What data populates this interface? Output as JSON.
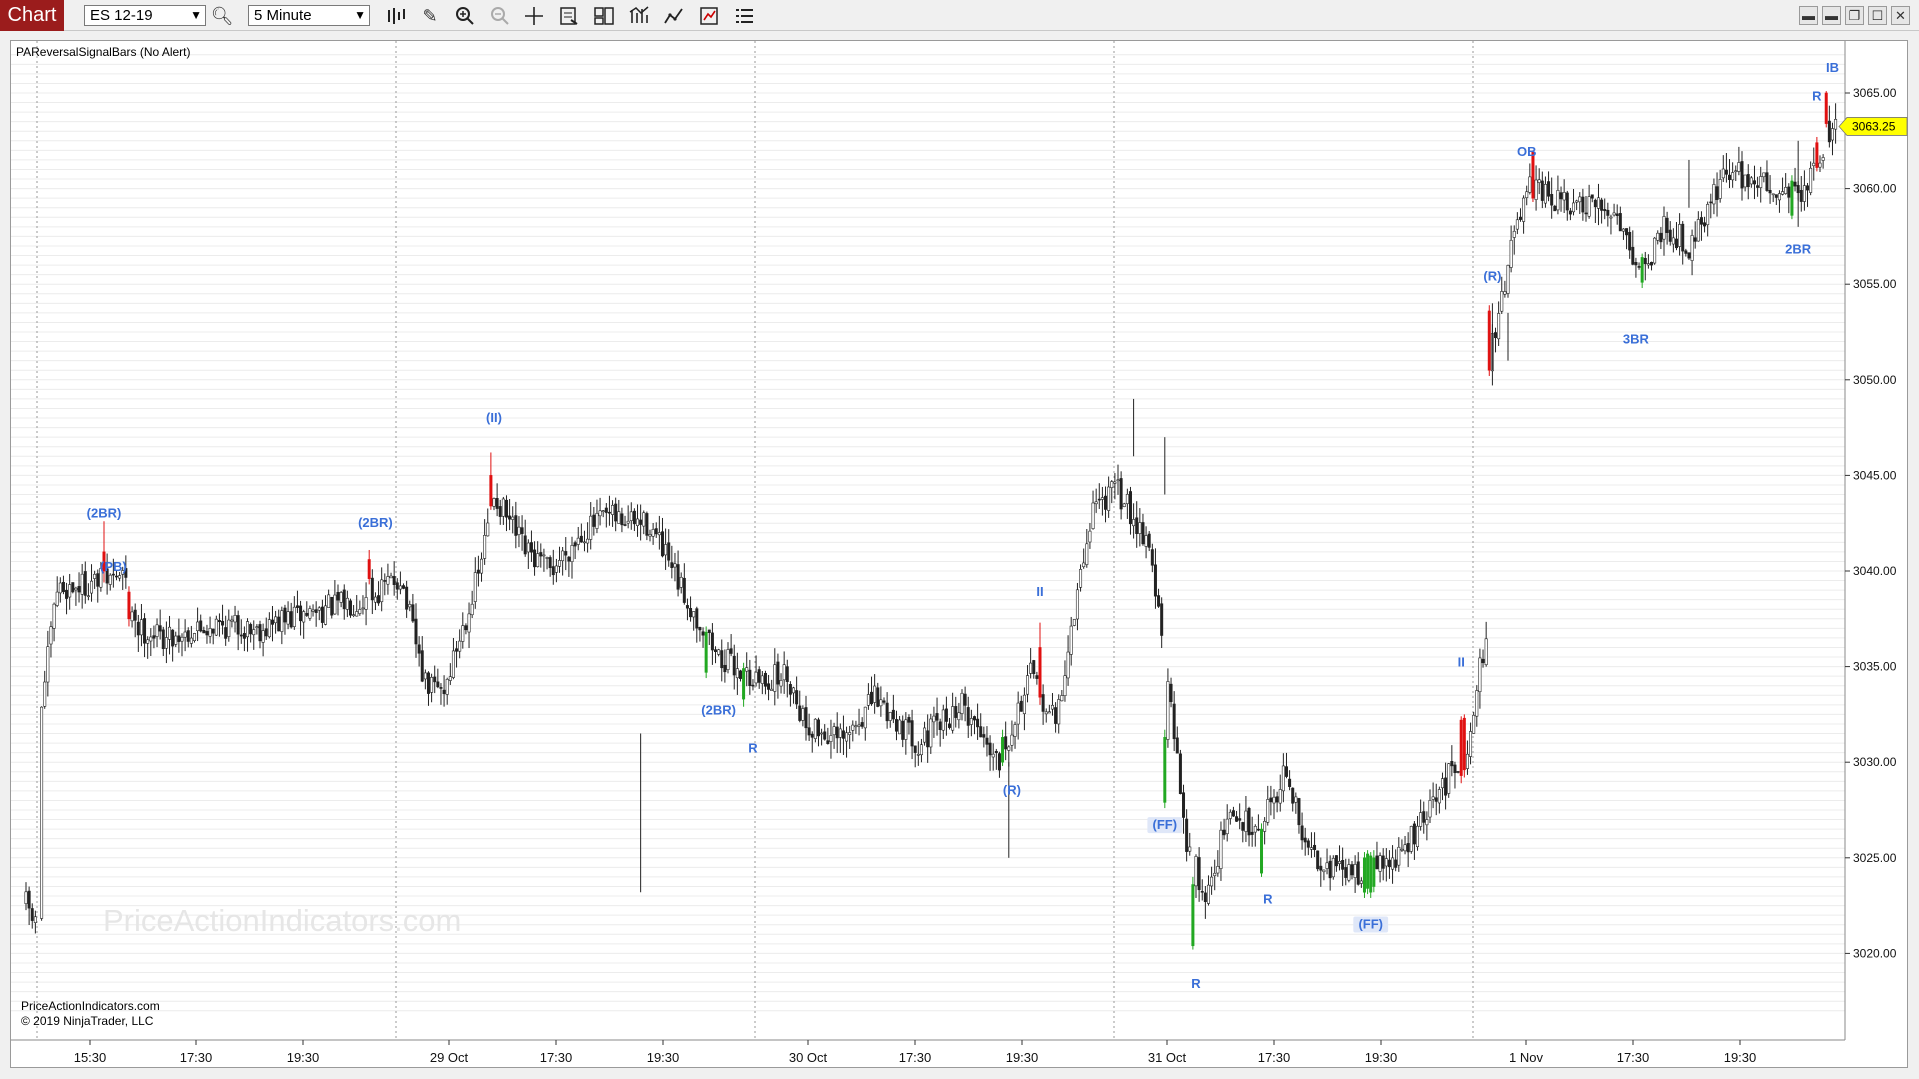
{
  "toolbar": {
    "tab_label": "Chart",
    "instrument": "ES 12-19",
    "timeframe": "5 Minute",
    "icons": [
      "bar-type-icon",
      "draw-tool-icon",
      "zoom-in-icon",
      "zoom-out-icon",
      "crosshair-icon",
      "properties-icon",
      "data-box-icon",
      "indicators-icon",
      "strategies-icon",
      "chart-trader-icon",
      "menu-icon"
    ],
    "window_buttons": [
      "tile-icon",
      "tile-icon",
      "restore-icon",
      "maximize-icon",
      "close-icon"
    ]
  },
  "chart": {
    "indicator_label": "PAReversalSignalBars (No Alert)",
    "watermark": "PriceActionIndicators.com",
    "copyright_lines": [
      "PriceActionIndicators.com",
      "© 2019 NinjaTrader, LLC"
    ],
    "last_price": "3063.25",
    "colors": {
      "bullish_signal": "#22a822",
      "bearish_signal": "#e01010",
      "signal_label": "#3a6fd8",
      "price_badge": "#ffff00"
    }
  },
  "chart_data": {
    "type": "candlestick",
    "y_tick_labels": [
      "3065.00",
      "3060.00",
      "3055.00",
      "3050.00",
      "3045.00",
      "3040.00",
      "3035.00",
      "3030.00",
      "3025.00",
      "3020.00"
    ],
    "x_tick_labels": [
      "15:30",
      "17:30",
      "19:30",
      "29 Oct",
      "17:30",
      "19:30",
      "30 Oct",
      "17:30",
      "19:30",
      "31 Oct",
      "17:30",
      "19:30",
      "1 Nov",
      "17:30",
      "19:30"
    ],
    "ylim": [
      3017.0,
      3067.0
    ],
    "grid": true,
    "session_breaks": [
      "29 Oct",
      "30 Oct",
      "31 Oct",
      "1 Nov"
    ],
    "signal_labels": [
      {
        "text": "(2BR)",
        "price": 3042.8,
        "bar": 25,
        "kind": "bear"
      },
      {
        "text": "(PB)",
        "price": 3040.0,
        "bar": 28,
        "kind": "bear"
      },
      {
        "text": "(2BR)",
        "price": 3042.3,
        "bar": 112,
        "kind": "bear"
      },
      {
        "text": "(II)",
        "price": 3047.8,
        "bar": 150,
        "kind": "bear"
      },
      {
        "text": "(2BR)",
        "price": 3032.5,
        "bar": 222,
        "kind": "bull"
      },
      {
        "text": "R",
        "price": 3030.5,
        "bar": 233,
        "kind": "bull"
      },
      {
        "text": "II",
        "price": 3038.7,
        "bar": 325,
        "kind": "bear"
      },
      {
        "text": "(R)",
        "price": 3028.3,
        "bar": 316,
        "kind": "bull"
      },
      {
        "text": "(FF)",
        "price": 3026.5,
        "bar": 365,
        "kind": "bull",
        "boxed": true
      },
      {
        "text": "R",
        "price": 3018.2,
        "bar": 375,
        "kind": "bull"
      },
      {
        "text": "R",
        "price": 3022.6,
        "bar": 398,
        "kind": "bull"
      },
      {
        "text": "(FF)",
        "price": 3021.3,
        "bar": 431,
        "kind": "bull",
        "boxed": true
      },
      {
        "text": "II",
        "price": 3035.0,
        "bar": 460,
        "kind": "bear"
      },
      {
        "text": "(R)",
        "price": 3055.2,
        "bar": 470,
        "kind": "bear"
      },
      {
        "text": "OB",
        "price": 3061.7,
        "bar": 481,
        "kind": "bear"
      },
      {
        "text": "3BR",
        "price": 3051.9,
        "bar": 516,
        "kind": "bull"
      },
      {
        "text": "2BR",
        "price": 3056.6,
        "bar": 568,
        "kind": "bull"
      },
      {
        "text": "R",
        "price": 3064.6,
        "bar": 574,
        "kind": "bear"
      },
      {
        "text": "IB",
        "price": 3066.1,
        "bar": 579,
        "kind": "bear"
      }
    ],
    "signal_bars": [
      {
        "bar": 25,
        "open": 3041.0,
        "close": 3040.0,
        "high": 3042.6,
        "low": 3039.4,
        "kind": "bear"
      },
      {
        "bar": 33,
        "open": 3038.9,
        "close": 3037.5,
        "high": 3039.2,
        "low": 3037.1,
        "kind": "bear"
      },
      {
        "bar": 110,
        "open": 3040.6,
        "close": 3039.6,
        "high": 3041.1,
        "low": 3039.3,
        "kind": "bear"
      },
      {
        "bar": 149,
        "open": 3045.0,
        "close": 3043.4,
        "high": 3046.2,
        "low": 3043.2,
        "kind": "bear"
      },
      {
        "bar": 218,
        "open": 3034.7,
        "close": 3036.8,
        "high": 3037.1,
        "low": 3034.4,
        "kind": "bull"
      },
      {
        "bar": 230,
        "open": 3033.3,
        "close": 3034.9,
        "high": 3035.2,
        "low": 3032.9,
        "kind": "bull"
      },
      {
        "bar": 313,
        "open": 3030.0,
        "close": 3031.3,
        "high": 3031.7,
        "low": 3029.8,
        "kind": "bull"
      },
      {
        "bar": 325,
        "open": 3036.0,
        "close": 3033.4,
        "high": 3037.3,
        "low": 3033.0,
        "kind": "bear"
      },
      {
        "bar": 365,
        "open": 3027.9,
        "close": 3031.3,
        "high": 3031.7,
        "low": 3027.6,
        "kind": "bull"
      },
      {
        "bar": 374,
        "open": 3020.4,
        "close": 3023.6,
        "high": 3024.0,
        "low": 3020.2,
        "kind": "bull"
      },
      {
        "bar": 396,
        "open": 3024.2,
        "close": 3026.5,
        "high": 3026.8,
        "low": 3024.0,
        "kind": "bull"
      },
      {
        "bar": 429,
        "open": 3023.2,
        "close": 3025.0,
        "high": 3025.3,
        "low": 3022.9,
        "kind": "bull"
      },
      {
        "bar": 430,
        "open": 3023.4,
        "close": 3025.2,
        "high": 3025.4,
        "low": 3023.1,
        "kind": "bull"
      },
      {
        "bar": 431,
        "open": 3023.2,
        "close": 3025.1,
        "high": 3025.3,
        "low": 3022.9,
        "kind": "bull"
      },
      {
        "bar": 432,
        "open": 3023.5,
        "close": 3025.0,
        "high": 3025.4,
        "low": 3023.2,
        "kind": "bull"
      },
      {
        "bar": 460,
        "open": 3032.2,
        "close": 3029.3,
        "high": 3032.4,
        "low": 3028.9,
        "kind": "bear"
      },
      {
        "bar": 461,
        "open": 3032.3,
        "close": 3029.6,
        "high": 3032.5,
        "low": 3029.2,
        "kind": "bear"
      },
      {
        "bar": 469,
        "open": 3053.6,
        "close": 3050.5,
        "high": 3053.9,
        "low": 3050.2,
        "kind": "bear"
      },
      {
        "bar": 483,
        "open": 3061.9,
        "close": 3059.5,
        "high": 3062.0,
        "low": 3059.3,
        "kind": "bear"
      },
      {
        "bar": 518,
        "open": 3055.1,
        "close": 3056.4,
        "high": 3056.6,
        "low": 3054.8,
        "kind": "bull"
      },
      {
        "bar": 566,
        "open": 3058.6,
        "close": 3060.4,
        "high": 3060.7,
        "low": 3058.4,
        "kind": "bull"
      },
      {
        "bar": 574,
        "open": 3062.4,
        "close": 3061.1,
        "high": 3062.7,
        "low": 3060.9,
        "kind": "bear"
      },
      {
        "bar": 577,
        "open": 3065.0,
        "close": 3063.4,
        "high": 3065.1,
        "low": 3063.2,
        "kind": "bear"
      }
    ],
    "price_path": [
      [
        0,
        3022.6
      ],
      [
        3,
        3021.5
      ],
      [
        5,
        3033.0
      ],
      [
        10,
        3039.0
      ],
      [
        25,
        3039.5
      ],
      [
        31,
        3039.8
      ],
      [
        36,
        3037.0
      ],
      [
        45,
        3036.5
      ],
      [
        60,
        3037.2
      ],
      [
        75,
        3037.0
      ],
      [
        90,
        3037.8
      ],
      [
        110,
        3038.6
      ],
      [
        120,
        3039.7
      ],
      [
        128,
        3034.0
      ],
      [
        134,
        3033.8
      ],
      [
        145,
        3039.8
      ],
      [
        150,
        3044.0
      ],
      [
        160,
        3041.0
      ],
      [
        168,
        3040.0
      ],
      [
        178,
        3042.0
      ],
      [
        186,
        3042.8
      ],
      [
        200,
        3042.4
      ],
      [
        210,
        3039.0
      ],
      [
        222,
        3035.5
      ],
      [
        235,
        3034.2
      ],
      [
        244,
        3034.6
      ],
      [
        250,
        3032.0
      ],
      [
        262,
        3031.0
      ],
      [
        272,
        3033.4
      ],
      [
        286,
        3031.0
      ],
      [
        300,
        3033.0
      ],
      [
        312,
        3030.2
      ],
      [
        322,
        3034.5
      ],
      [
        330,
        3032.0
      ],
      [
        342,
        3043.5
      ],
      [
        350,
        3044.2
      ],
      [
        360,
        3041.5
      ],
      [
        366,
        3034.0
      ],
      [
        372,
        3026.0
      ],
      [
        378,
        3022.8
      ],
      [
        385,
        3027.0
      ],
      [
        395,
        3026.8
      ],
      [
        404,
        3029.5
      ],
      [
        410,
        3025.5
      ],
      [
        422,
        3024.2
      ],
      [
        432,
        3024.4
      ],
      [
        440,
        3025.0
      ],
      [
        450,
        3027.5
      ],
      [
        462,
        3031.0
      ],
      [
        468,
        3036.8
      ],
      [
        470,
        3051.8
      ],
      [
        476,
        3057.0
      ],
      [
        482,
        3060.0
      ],
      [
        495,
        3059.0
      ],
      [
        510,
        3058.8
      ],
      [
        518,
        3055.4
      ],
      [
        525,
        3058.2
      ],
      [
        533,
        3057.0
      ],
      [
        545,
        3061.0
      ],
      [
        560,
        3060.0
      ],
      [
        570,
        3059.8
      ],
      [
        580,
        3063.2
      ]
    ]
  }
}
